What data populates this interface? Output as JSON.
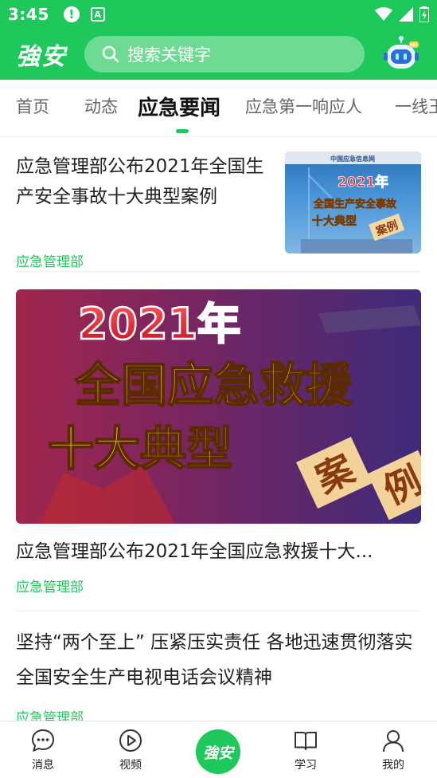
{
  "status_bar": {
    "time": "3:45",
    "icons": [
      "alert-icon",
      "a-icon",
      "wifi-icon",
      "signal-icon",
      "battery-icon"
    ]
  },
  "header": {
    "logo": "強安",
    "search_placeholder": "搜索关键字"
  },
  "tabs": [
    {
      "label": "首页",
      "active": false
    },
    {
      "label": "动态",
      "active": false
    },
    {
      "label": "应急要闻",
      "active": true
    },
    {
      "label": "应急第一响应人",
      "active": false
    },
    {
      "label": "一线王",
      "active": false
    }
  ],
  "feed": [
    {
      "title": "应急管理部公布2021年全国生产安全事故十大典型案例",
      "source": "应急管理部",
      "thumb": {
        "brand": "中国应急信息网",
        "line1": "2021年",
        "line2": "全国生产安全事故",
        "line3": "十大典型",
        "line4": "案例"
      }
    },
    {
      "title": "应急管理部公布2021年全国应急救援十大...",
      "source": "应急管理部",
      "banner": {
        "line1": "2021年",
        "line2": "全国应急救援",
        "line3": "十大典型",
        "tag1": "案",
        "tag2": "例"
      }
    },
    {
      "title": "坚持“两个至上” 压紧压实责任 各地迅速贯彻落实全国安全生产电视电话会议精神",
      "source": "应急管理部"
    }
  ],
  "bottom_nav": [
    {
      "label": "消息",
      "icon": "message-icon"
    },
    {
      "label": "视频",
      "icon": "video-play-icon"
    },
    {
      "label": "強安",
      "icon": "home-logo"
    },
    {
      "label": "学习",
      "icon": "book-icon"
    },
    {
      "label": "我的",
      "icon": "profile-icon"
    }
  ],
  "colors": {
    "brand_green": "#1fc85a"
  }
}
